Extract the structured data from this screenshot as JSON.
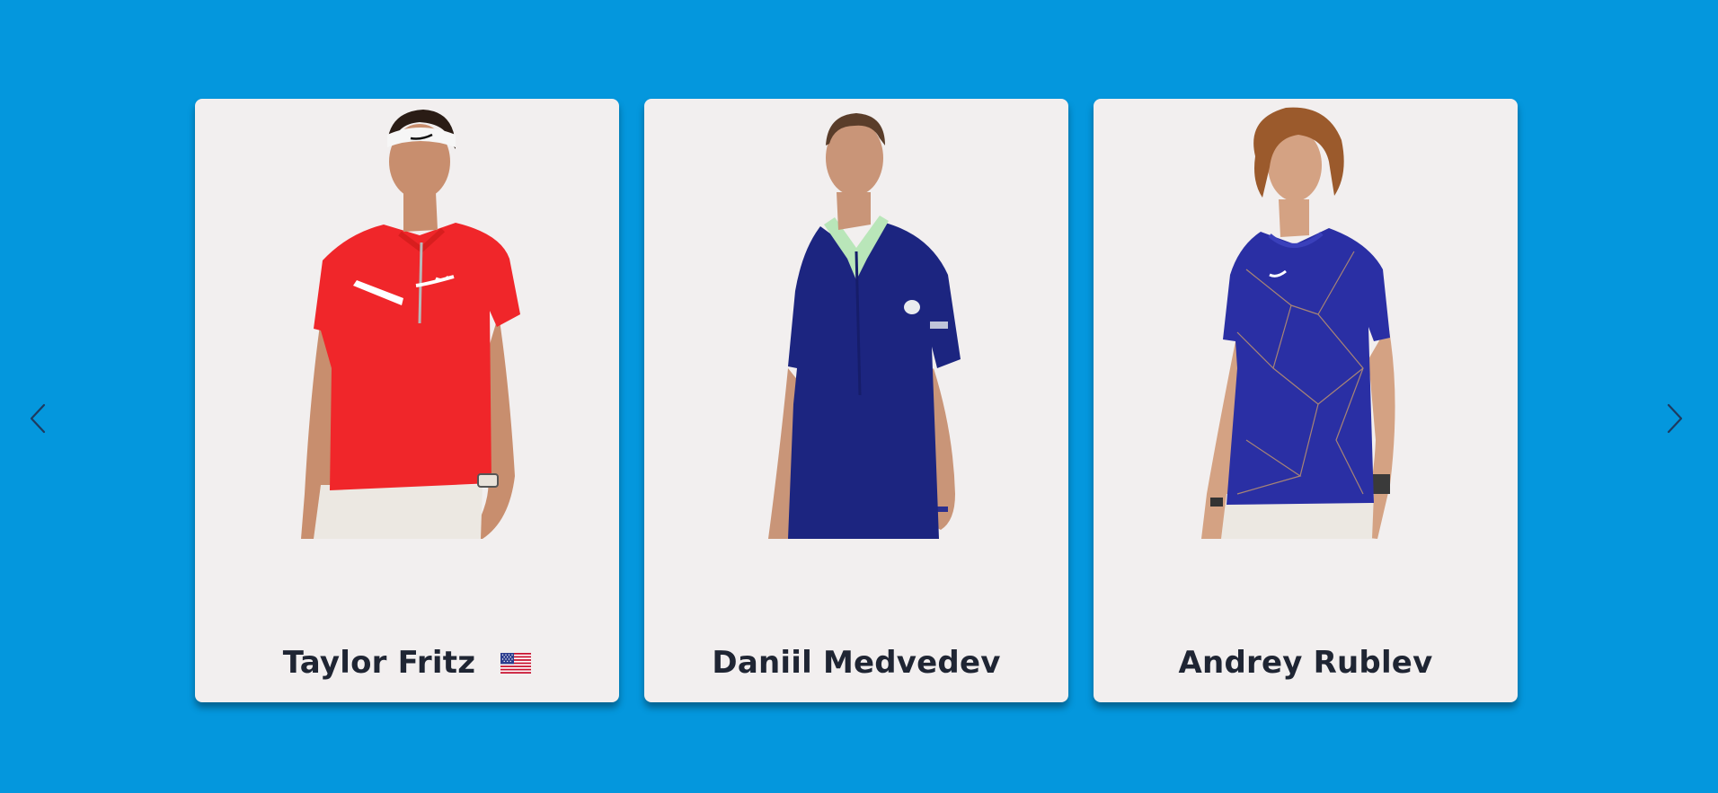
{
  "carousel": {
    "prev_label": "Previous",
    "next_label": "Next",
    "players": [
      {
        "name": "Taylor Fritz",
        "flag": "us-flag-icon",
        "shirt_color": "#f0262a",
        "shorts_color": "#ece8e2",
        "shirt_trim": "#ffffff"
      },
      {
        "name": "Daniil Medvedev",
        "flag": "",
        "shirt_color": "#1c2580",
        "shorts_color": "",
        "shirt_trim": "#b9e6b9"
      },
      {
        "name": "Andrey Rublev",
        "flag": "",
        "shirt_color": "#2a2fa4",
        "shorts_color": "#ece8e2",
        "shirt_trim": "#c79a6a"
      }
    ]
  },
  "colors": {
    "background": "#0497dd",
    "card": "#f2efef",
    "name_text": "#1f2533",
    "arrow": "#1e3a5f"
  }
}
